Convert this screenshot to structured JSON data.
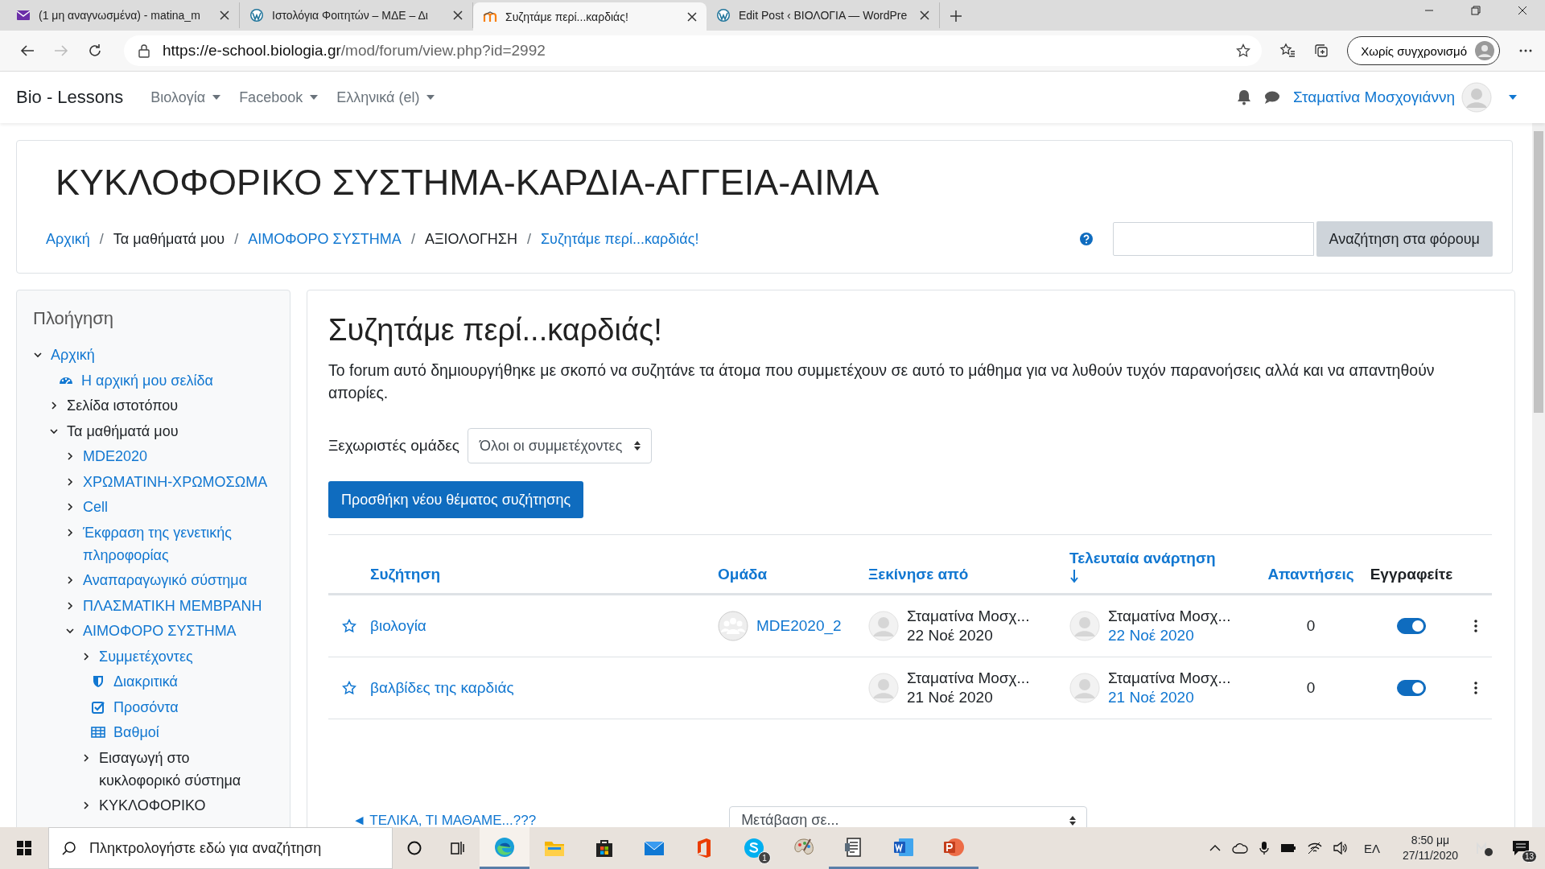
{
  "browser": {
    "tabs": [
      {
        "title": "(1 μη αναγνωσμένα) - matina_m",
        "kind": "mail",
        "selected": false
      },
      {
        "title": "Ιστολόγια Φοιτητών – ΜΔΕ – Δι",
        "kind": "wordpress",
        "selected": false
      },
      {
        "title": "Συζητάμε περί...καρδιάς!",
        "kind": "moodle",
        "selected": true
      },
      {
        "title": "Edit Post ‹ ΒΙΟΛΟΓΙΑ — WordPre",
        "kind": "wordpress",
        "selected": false
      }
    ],
    "url_host": "https://e-school.biologia.gr",
    "url_path": "/mod/forum/view.php?id=2992",
    "sync_label": "Χωρίς συγχρονισμό"
  },
  "navbar": {
    "brand": "Bio - Lessons",
    "menus": [
      "Βιολογία",
      "Facebook",
      "Ελληνικά (el)"
    ],
    "user_name": "Σταματίνα Μοσχογιάννη"
  },
  "header": {
    "title": "ΚΥΚΛΟΦΟΡΙΚΟ ΣΥΣΤΗΜΑ-ΚΑΡΔΙΑ-ΑΓΓΕΙΑ-ΑΙΜΑ",
    "separator": "/",
    "breadcrumbs": [
      {
        "label": "Αρχική",
        "link": true
      },
      {
        "label": "Τα μαθήματά μου",
        "link": false
      },
      {
        "label": "ΑΙΜΟΦΟΡΟ ΣΥΣΤΗΜΑ",
        "link": true
      },
      {
        "label": "ΑΞΙΟΛΟΓΗΣΗ",
        "link": false
      },
      {
        "label": "Συζητάμε περί...καρδιάς!",
        "link": true
      }
    ],
    "search_button": "Αναζήτηση στα φόρουμ"
  },
  "sidebar": {
    "title": "Πλοήγηση",
    "tree": [
      {
        "label": "Αρχική",
        "link": true,
        "expanded": true,
        "children": [
          {
            "label": "Η αρχική μου σελίδα",
            "link": true,
            "kind": "dashboard"
          },
          {
            "label": "Σελίδα ιστοτόπου",
            "link": false,
            "expanded": false
          },
          {
            "label": "Τα μαθήματά μου",
            "link": false,
            "expanded": true,
            "children": [
              {
                "label": "MDE2020",
                "link": true,
                "expanded": false
              },
              {
                "label": "ΧΡΩΜΑΤΙΝΗ-ΧΡΩΜΟΣΩΜΑ",
                "link": true,
                "expanded": false
              },
              {
                "label": "Cell",
                "link": true,
                "expanded": false
              },
              {
                "label": "Έκφραση της γενετικής πληροφορίας",
                "link": true,
                "expanded": false
              },
              {
                "label": "Αναπαραγωγικό σύστημα",
                "link": true,
                "expanded": false
              },
              {
                "label": "ΠΛΑΣΜΑΤΙΚΗ ΜΕΜΒΡΑΝΗ",
                "link": true,
                "expanded": false
              },
              {
                "label": "ΑΙΜΟΦΟΡΟ ΣΥΣΤΗΜΑ",
                "link": true,
                "expanded": true,
                "children": [
                  {
                    "label": "Συμμετέχοντες",
                    "link": true,
                    "expanded": false
                  },
                  {
                    "label": "Διακριτικά",
                    "link": true,
                    "kind": "shield"
                  },
                  {
                    "label": "Προσόντα",
                    "link": true,
                    "kind": "checkbox"
                  },
                  {
                    "label": "Βαθμοί",
                    "link": true,
                    "kind": "table"
                  },
                  {
                    "label": "Εισαγωγή στο κυκλοφορικό σύστημα",
                    "link": false,
                    "expanded": false
                  },
                  {
                    "label": "ΚΥΚΛΟΦΟΡΙΚΟ",
                    "link": false,
                    "expanded": false
                  }
                ]
              }
            ]
          }
        ]
      }
    ]
  },
  "forum": {
    "title": "Συζητάμε περί...καρδιάς!",
    "description": "Το forum αυτό δημιουργήθηκε με σκοπό να συζητάνε τα άτομα που συμμετέχουν σε αυτό το μάθημα για να λυθούν τυχόν παρανοήσεις αλλά και να απαντηθούν απορίες.",
    "groups_label": "Ξεχωριστές ομάδες",
    "groups_value": "Όλοι οι συμμετέχοντες",
    "add_button": "Προσθήκη νέου θέματος συζήτησης",
    "columns": [
      {
        "label": "Συζήτηση",
        "link": true,
        "sorted": false
      },
      {
        "label": "Ομάδα",
        "link": true,
        "sorted": false
      },
      {
        "label": "Ξεκίνησε από",
        "link": true,
        "sorted": false
      },
      {
        "label": "Τελευταία ανάρτηση",
        "link": true,
        "sorted": true
      },
      {
        "label": "Απαντήσεις",
        "link": true,
        "sorted": false
      },
      {
        "label": "Εγγραφείτε",
        "link": false,
        "sorted": false
      }
    ],
    "rows": [
      {
        "title": "βιολογία",
        "starred": false,
        "group": "MDE2020_2",
        "started_name": "Σταματίνα Μοσχ...",
        "started_date": "22 Νοέ 2020",
        "last_name": "Σταματίνα Μοσχ...",
        "last_date": "22 Νοέ 2020",
        "replies": "0",
        "subscribed": true
      },
      {
        "title": "βαλβίδες της καρδιάς",
        "starred": false,
        "started_name": "Σταματίνα Μοσχ...",
        "started_date": "21 Νοέ 2020",
        "last_name": "Σταματίνα Μοσχ...",
        "last_date": "21 Νοέ 2020",
        "replies": "0",
        "subscribed": true
      }
    ],
    "prev_link": "◄ ΤΕΛΙΚΑ, ΤΙ ΜΑΘΑΜΕ...???",
    "jump_label": "Μετάβαση σε..."
  },
  "taskbar": {
    "search_placeholder": "Πληκτρολογήστε εδώ για αναζήτηση",
    "apps": [
      {
        "kind": "edge",
        "running": true,
        "active": true
      },
      {
        "kind": "explorer",
        "running": false,
        "active": false
      },
      {
        "kind": "store",
        "running": false,
        "active": false
      },
      {
        "kind": "mail",
        "running": false,
        "active": false
      },
      {
        "kind": "office",
        "running": false,
        "active": false
      },
      {
        "kind": "skype",
        "running": false,
        "active": false,
        "badge": "1"
      },
      {
        "kind": "paint",
        "running": false,
        "active": false
      },
      {
        "kind": "document",
        "running": true,
        "active": false
      },
      {
        "kind": "word",
        "running": true,
        "active": false
      },
      {
        "kind": "powerpoint",
        "running": true,
        "active": false
      }
    ],
    "language": "ΕΛ",
    "time": "8:50 μμ",
    "date": "27/11/2020",
    "notifications": "13"
  }
}
